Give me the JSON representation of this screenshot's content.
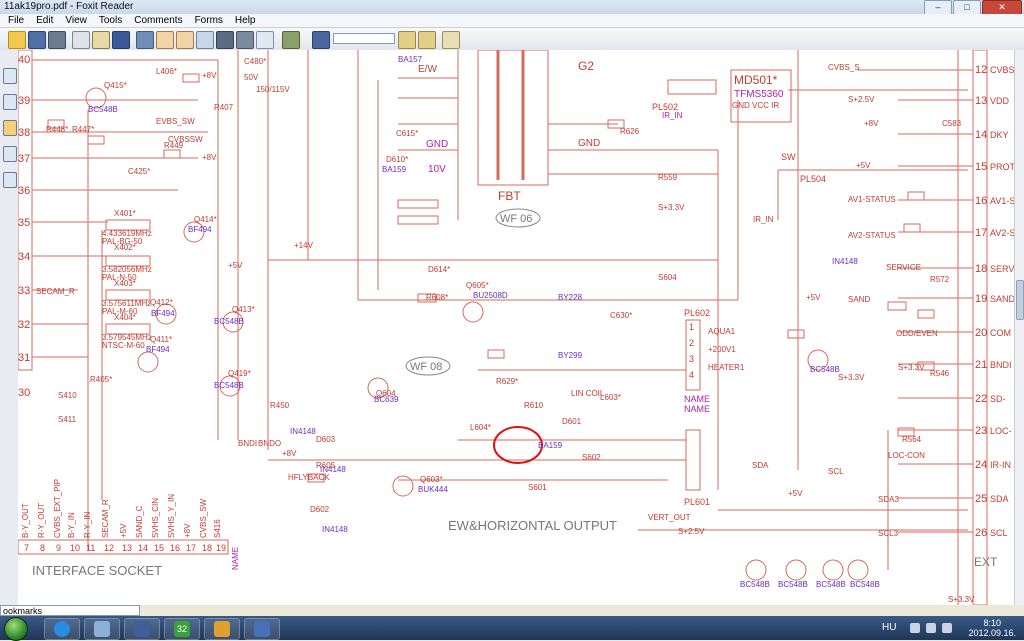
{
  "window": {
    "title": "11ak19pro.pdf - Foxit Reader",
    "controls": {
      "minimize": "–",
      "maximize": "□",
      "close": "✕"
    }
  },
  "menu": [
    "File",
    "Edit",
    "View",
    "Tools",
    "Comments",
    "Forms",
    "Help"
  ],
  "toolbar": {
    "search_value": "",
    "icons": [
      "open-icon",
      "save-icon",
      "print-icon",
      "email-icon",
      "facebook-icon",
      "fit-page-icon",
      "hand-tool-icon",
      "select-tool-icon",
      "snapshot-icon",
      "zoom-in-icon",
      "typewriter-icon",
      "highlight-icon",
      "find-icon",
      "find-prev-icon",
      "find-next-icon"
    ]
  },
  "sidebar": {
    "icons": [
      "pages-icon",
      "bookmarks-icon",
      "comments-icon",
      "attachments-icon",
      "layers-icon"
    ]
  },
  "bookmarks_panel": {
    "label": "ookmarks"
  },
  "schematic": {
    "connector_left": {
      "pins": [
        "40",
        "39",
        "38",
        "37",
        "36",
        "35",
        "34",
        "33",
        "32",
        "31",
        "30"
      ],
      "signals": [
        "SECAM_R"
      ]
    },
    "connector_right": {
      "pins": [
        "12",
        "13",
        "14",
        "15",
        "16",
        "17",
        "18",
        "19",
        "20",
        "21",
        "22",
        "23",
        "24",
        "25",
        "26"
      ],
      "signals": [
        "CVBS",
        "VDD",
        "DKY",
        "PROT",
        "AV1-S",
        "AV2-S",
        "SERV",
        "SAND",
        "COM",
        "BNDI",
        "SD-",
        "LOC-",
        "IR-IN",
        "SDA",
        "SCL"
      ]
    },
    "labels": {
      "ew": "E/W",
      "fbt": "FBT",
      "g2": "G2",
      "gnd1": "GND",
      "gnd2": "GND",
      "v10": "10V",
      "ir_in": "IR_IN",
      "ir_in2": "IR_IN",
      "md501": "MD501*",
      "tfms": "TFMS5360",
      "gndvcc": "GND VCC IR",
      "pl502": "PL502",
      "pl504": "PL504",
      "sw": "SW",
      "pl602": "PL602",
      "pl601": "PL601",
      "wf06": "WF 06",
      "wf08": "WF 08",
      "ew_horiz": "EW&HORIZONTAL OUTPUT",
      "interface": "INTERFACE SOCKET",
      "heater": "HEATER1",
      "v200": "+200V1",
      "aqua": "AQUA1",
      "name1": "NAME",
      "name2": "NAME",
      "name3": "NAME",
      "vert": "VERT_OUT",
      "vert2": "VERT_OUT",
      "hflyback": "HFLYBACK",
      "bndi": "BNDI",
      "bndo": "BNDO",
      "av1": "AV1-STATUS",
      "av2": "AV2-STATUS",
      "service": "SERVICE",
      "sand": "SAND",
      "oddeven": "ODD/EVEN",
      "sda": "SDA",
      "scl": "SCL",
      "sda3": "SDA3",
      "scl3": "SCL3",
      "loccon": "LOC-CON",
      "ext": "EXT",
      "cvbs_s": "CVBS_S",
      "evbs_sw": "EVBS_SW",
      "cvbssw": "CVBSSW",
      "secam": "SECAM_R",
      "linconv": "LIN COIL"
    },
    "parts": {
      "bc548b_1": "BC548B",
      "bc548b_2": "BC548B",
      "bc548b_3": "BC548B",
      "bc548b_4": "BC548B",
      "bc548b_5": "BC548B",
      "bc548b_6": "BC548B",
      "bc548b_7": "BC548B",
      "bc548b_8": "BC548B",
      "bf494_1": "BF494",
      "bf494_2": "BF494",
      "bf494_3": "BF494",
      "bc639": "BC639",
      "bu2508d": "BU2508D",
      "buk444": "BUK444",
      "ba159_1": "BA159",
      "ba159_2": "BA159",
      "ba157": "BA157",
      "by228": "BY228",
      "by299": "BY299",
      "in4148_1": "IN4148",
      "in4148_2": "IN4148",
      "in4148_3": "IN4148",
      "in4148_4": "IN4148",
      "q415": "Q415*",
      "q414": "Q414*",
      "q412": "Q412*",
      "q413": "Q413*",
      "q411": "Q411*",
      "q419": "Q419*",
      "q604": "Q604",
      "q605": "Q605*",
      "q603": "Q603*",
      "d614": "D614*",
      "d603": "D603",
      "d602": "D602",
      "d601": "D601",
      "d610": "D610*",
      "r608": "R608*",
      "r605": "R605",
      "r629": "R629*",
      "r610": "R610",
      "r626": "R626",
      "r559": "R559",
      "r572": "R572",
      "r546": "R546",
      "r564": "R564",
      "r448": "R448*",
      "r447": "R447*",
      "r449": "R449",
      "r450": "R450",
      "c615": "C615*",
      "c630": "C630*",
      "c583": "C583",
      "x401": "X401*",
      "x402": "X402*",
      "x403": "X403*",
      "x404": "X404*",
      "xtal1": "4.433619MHz",
      "xtal1b": "PAL-BG-50",
      "xtal2": "3.582056MHz",
      "xtal2b": "PAL-N-50",
      "xtal3": "3.575611MHz",
      "xtal3b": "PAL-M-60",
      "xtal4": "3.579545MHz",
      "xtal4b": "NTSC-M-60",
      "l406": "L406*",
      "l604": "L604*",
      "l603": "L603*",
      "s410": "S410",
      "s411": "S411",
      "s601": "S601",
      "s604": "S604",
      "s602": "S602",
      "v14": "+14V",
      "v8a": "+8V",
      "v8b": "+8V",
      "v8c": "+8V",
      "v8d": "+8V",
      "v5a": "+5V",
      "v5b": "+5V",
      "v5c": "+5V",
      "v25a": "S+2.5V",
      "v25b": "S+2.5V",
      "v33a": "S+3.3V",
      "v33b": "S+3.3V",
      "v33c": "S+3.3V",
      "v33d": "S+3.3V",
      "v5d": "+5V",
      "v50": "50V",
      "v150": "150/115V",
      "c480": "C480*",
      "r407": "R407",
      "r405": "R405*",
      "c425": "C425*"
    },
    "interface_pins": [
      "7",
      "8",
      "9",
      "10",
      "11",
      "12",
      "13",
      "14",
      "15",
      "16",
      "17",
      "18",
      "19"
    ],
    "interface_signals": [
      "B-Y_OUT",
      "R-Y_OUT",
      "CVBS_EXT_PIP",
      "B-Y_IN",
      "R-Y_IN",
      "SECAM_R",
      "+5V",
      "SAND_C",
      "SVHS_CIN",
      "SVHS_Y_IN",
      "+8V",
      "CVBS_SW",
      "S416",
      "NAME"
    ],
    "right_pins": [
      "1",
      "2",
      "3",
      "4"
    ],
    "bottom_parts": [
      "Q515",
      "Q516",
      "Q517",
      "Q518",
      "BC548B",
      "BC548B",
      "BC548B",
      "BC548B"
    ]
  },
  "taskbar": {
    "apps": [
      "ie-icon",
      "network-icon",
      "save-icon",
      "calendar-icon",
      "draw-icon",
      "foxit-icon"
    ],
    "calendar_num": "32",
    "lang": "HU",
    "time": "8:10",
    "date": "2012.09.16."
  }
}
